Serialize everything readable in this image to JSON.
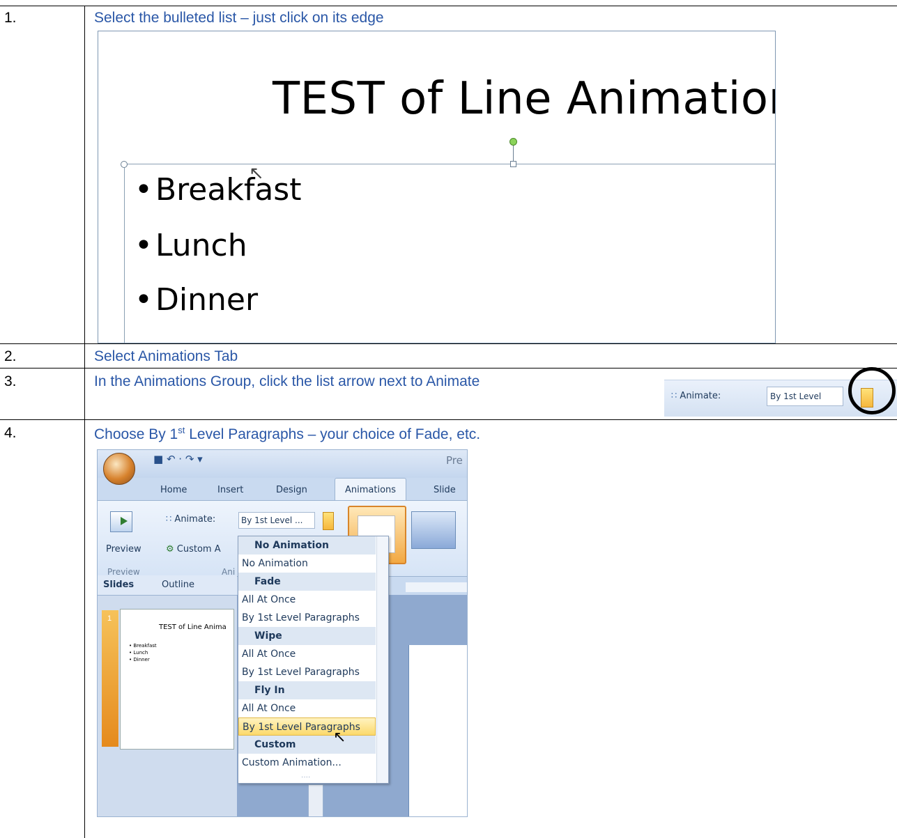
{
  "steps": [
    {
      "num": "1.",
      "text": "Select the bulleted list – just click on its edge"
    },
    {
      "num": "2.",
      "text": "Select Animations Tab"
    },
    {
      "num": "3.",
      "text": "In the Animations Group, click the list arrow next to Animate"
    },
    {
      "num": "4.",
      "text_pre": "Choose By 1",
      "text_sup": "st",
      "text_post": " Level Paragraphs – your choice of Fade, etc."
    }
  ],
  "slide": {
    "title": "TEST of Line Animation",
    "bullets": [
      "Breakfast",
      "Lunch",
      "Dinner"
    ],
    "bullet_glyph": "•"
  },
  "animate_strip": {
    "label": "Animate:",
    "value": "By 1st Level"
  },
  "ppt": {
    "qat": "■ ↶ · ↷ ▾",
    "window_title": "Pre",
    "tabs": [
      "Home",
      "Insert",
      "Design",
      "Animations",
      "Slide"
    ],
    "active_tab": "Animations",
    "preview_label": "Preview",
    "preview_group": "Preview",
    "animate_label": "Animate:",
    "animate_value": "By 1st Level ...",
    "custom_label": "Custom A",
    "anim_group": "Ani",
    "pane_tabs": [
      "Slides",
      "Outline"
    ],
    "slide_number": "1",
    "mini_title": "TEST of Line Anima",
    "mini_bullets": [
      "• Breakfast",
      "• Lunch",
      "• Dinner"
    ]
  },
  "dropdown": [
    {
      "text": "No Animation",
      "type": "header"
    },
    {
      "text": "No Animation",
      "type": "item"
    },
    {
      "text": "Fade",
      "type": "header"
    },
    {
      "text": "All At Once",
      "type": "item"
    },
    {
      "text": "By 1st Level Paragraphs",
      "type": "item"
    },
    {
      "text": "Wipe",
      "type": "header"
    },
    {
      "text": "All At Once",
      "type": "item"
    },
    {
      "text": "By 1st Level Paragraphs",
      "type": "item"
    },
    {
      "text": "Fly In",
      "type": "header"
    },
    {
      "text": "All At Once",
      "type": "item"
    },
    {
      "text": "By 1st Level Paragraphs",
      "type": "highlighted"
    },
    {
      "text": "Custom",
      "type": "header"
    },
    {
      "text": "Custom Animation...",
      "type": "item"
    }
  ],
  "colors": {
    "step_text": "#2a57a7",
    "highlight": "#fbd96b"
  }
}
